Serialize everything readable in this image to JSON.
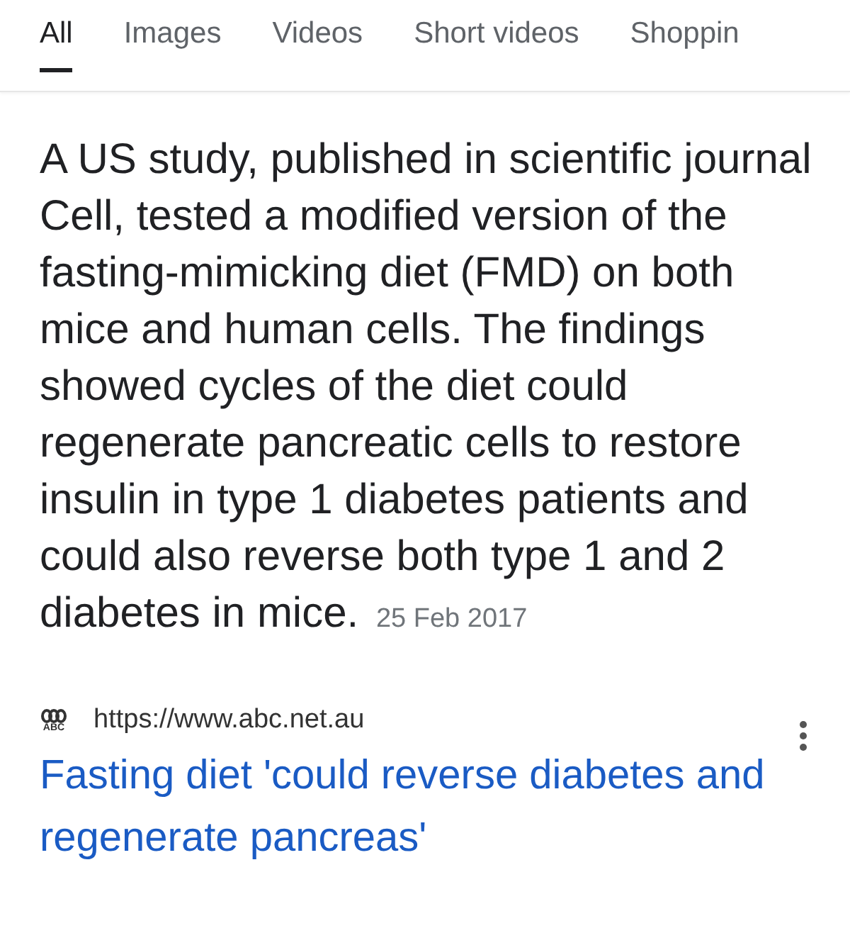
{
  "tabs": [
    {
      "label": "All",
      "selected": true
    },
    {
      "label": "Images",
      "selected": false
    },
    {
      "label": "Videos",
      "selected": false
    },
    {
      "label": "Short videos",
      "selected": false
    },
    {
      "label": "Shoppin",
      "selected": false
    }
  ],
  "result": {
    "snippet": "A US study, published in scientific journal Cell, tested a modified version of the fasting-mimicking diet (FMD) on both mice and human cells. The findings showed cycles of the diet could regenerate pancreatic cells to restore insulin in type 1 diabetes patients and could also reverse both type 1 and 2 diabetes in mice.",
    "date": "25 Feb 2017",
    "source_logo_text": "ABC",
    "url": "https://www.abc.net.au",
    "title": "Fasting diet 'could reverse diabetes and regenerate pancreas'"
  }
}
